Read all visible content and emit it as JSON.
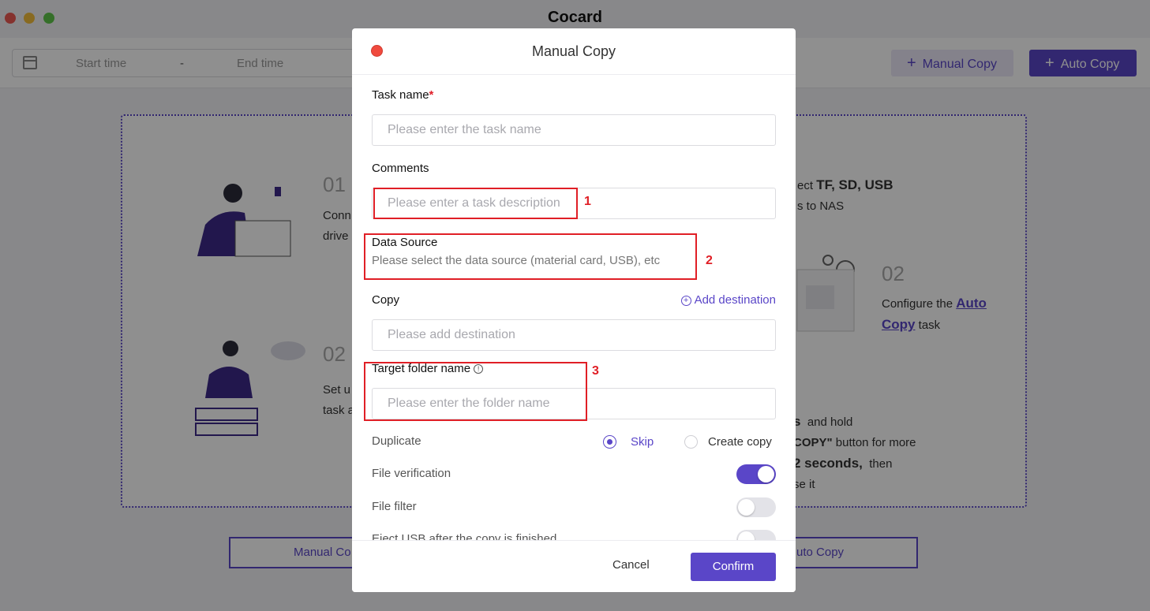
{
  "app": {
    "title": "Cocard",
    "traffic_colors": [
      "#ee5a52",
      "#f3be3c",
      "#5fc74a"
    ],
    "start_time": "Start time",
    "dash": "-",
    "end_time": "End time",
    "manual_copy_btn": "Manual Copy",
    "auto_copy_btn": "Auto Copy",
    "step1_num": "01",
    "step1_text_line1": "Conn",
    "step1_text_line2": "drive",
    "step1_right_line1_a": "ect",
    "step1_right_line1_b": "TF, SD, USB",
    "step1_right_line2": "s to NAS",
    "step2_num_left": "02",
    "step2_left_line1": "Set u",
    "step2_left_line2": "task a",
    "step2_num_right": "02",
    "step2_right_line1": "Configure the",
    "step2_right_link1": "Auto",
    "step2_right_link2": "Copy",
    "step2_right_line2": "task",
    "step3_line1_a": "s",
    "step3_line1_b": "and hold",
    "step3_line2_a": "COPY\"",
    "step3_line2_b": "button for more",
    "step3_line3_a": "2 seconds,",
    "step3_line3_b": "then",
    "step3_line4": "se it",
    "bottom_manual": "Manual Co",
    "bottom_auto": "uto Copy"
  },
  "modal": {
    "title": "Manual Copy",
    "task_name_label": "Task name",
    "required_mark": "*",
    "task_name_placeholder": "Please enter the task name",
    "comments_label": "Comments",
    "comments_placeholder": "Please enter a task description",
    "data_source_label": "Data Source",
    "data_source_hint": "Please select the data source (material card, USB), etc",
    "copy_label": "Copy",
    "add_destination": "Add destination",
    "destination_placeholder": "Please add destination",
    "target_folder_label": "Target folder name",
    "target_folder_placeholder": "Please enter the folder name",
    "duplicate_label": "Duplicate",
    "skip_label": "Skip",
    "create_copy_label": "Create copy",
    "file_verification_label": "File verification",
    "file_verification_on": true,
    "file_filter_label": "File filter",
    "file_filter_on": false,
    "eject_label": "Eject USB after the copy is finished",
    "cancel": "Cancel",
    "confirm": "Confirm",
    "accent_color": "#5a46c8"
  },
  "annotations": [
    "1",
    "2",
    "3"
  ]
}
